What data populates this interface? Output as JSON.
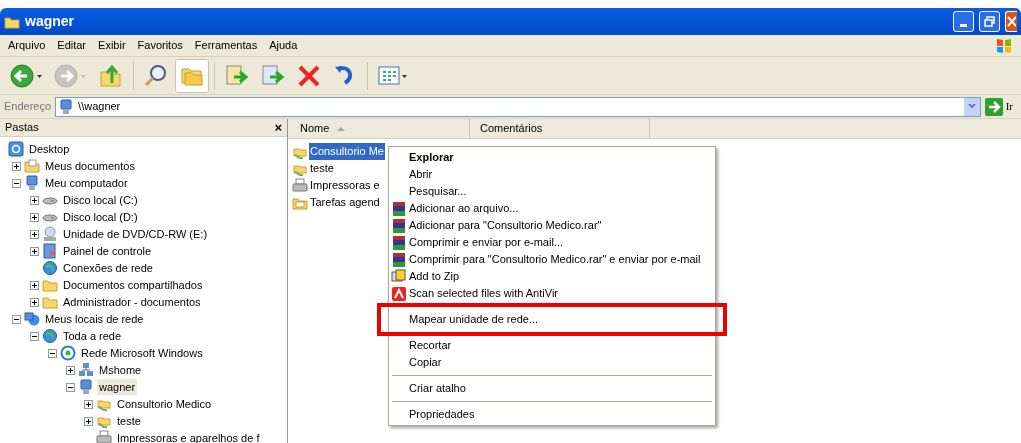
{
  "window": {
    "title": "wagner"
  },
  "menu": [
    "Arquivo",
    "Editar",
    "Exibir",
    "Favoritos",
    "Ferramentas",
    "Ajuda"
  ],
  "toolbar": [
    {
      "kind": "back",
      "disabled": false
    },
    {
      "kind": "forward",
      "disabled": true
    },
    {
      "kind": "up",
      "disabled": false
    },
    {
      "kind": "search",
      "disabled": false
    },
    {
      "kind": "folders",
      "disabled": false,
      "pressed": true
    },
    {
      "kind": "move",
      "disabled": false
    },
    {
      "kind": "copy",
      "disabled": false
    },
    {
      "kind": "delete",
      "disabled": false
    },
    {
      "kind": "undo",
      "disabled": false
    },
    {
      "kind": "views",
      "disabled": false
    }
  ],
  "address": {
    "label": "Endereço",
    "value": "\\\\wagner",
    "go": "Ir"
  },
  "folders_pane": {
    "title": "Pastas",
    "close": "×"
  },
  "tree": [
    {
      "label": "Desktop",
      "kind": "desktop",
      "children": [
        {
          "label": "Meus documentos",
          "kind": "docs",
          "expanded": false
        },
        {
          "label": "Meu computador",
          "kind": "computer",
          "expanded": true,
          "children": [
            {
              "label": "Disco local (C:)",
              "kind": "disk",
              "expanded": false
            },
            {
              "label": "Disco local (D:)",
              "kind": "disk",
              "expanded": false
            },
            {
              "label": "Unidade de DVD/CD-RW (E:)",
              "kind": "dvd",
              "expanded": false
            },
            {
              "label": "Painel de controle",
              "kind": "panel",
              "expanded": false
            },
            {
              "label": "Conexões de rede",
              "kind": "globe"
            },
            {
              "label": "Documentos compartilhados",
              "kind": "folder",
              "expanded": false
            },
            {
              "label": "Administrador - documentos",
              "kind": "folder",
              "expanded": false
            }
          ]
        },
        {
          "label": "Meus locais de rede",
          "kind": "network",
          "expanded": true,
          "children": [
            {
              "label": "Toda a rede",
              "kind": "globe",
              "expanded": true,
              "children": [
                {
                  "label": "Rede Microsoft Windows",
                  "kind": "msnet",
                  "expanded": true,
                  "children": [
                    {
                      "label": "Mshome",
                      "kind": "workgroup",
                      "expanded": false
                    },
                    {
                      "label": "wagner",
                      "kind": "computer",
                      "expanded": true,
                      "selected": true,
                      "children": [
                        {
                          "label": "Consultorio Medico",
                          "kind": "share",
                          "expanded": false,
                          "selected": false
                        },
                        {
                          "label": "teste",
                          "kind": "share",
                          "expanded": false,
                          "selected": false
                        },
                        {
                          "label": "Impressoras e aparelhos de f",
                          "kind": "printer",
                          "selected": false
                        }
                      ]
                    }
                  ]
                }
              ]
            }
          ]
        }
      ]
    }
  ],
  "columns": [
    "Nome",
    "Comentários"
  ],
  "files": [
    {
      "name": "Consultorio Me",
      "kind": "share",
      "selected": true
    },
    {
      "name": "teste",
      "kind": "share",
      "selected": false
    },
    {
      "name": "Impressoras e",
      "kind": "printer",
      "selected": false
    },
    {
      "name": "Tarefas agend",
      "kind": "tasks",
      "selected": false
    }
  ],
  "context_menu": [
    {
      "kind": "plain",
      "label": "Explorar",
      "bold": true
    },
    {
      "kind": "plain",
      "label": "Abrir",
      "bold": false
    },
    {
      "kind": "plain",
      "label": "Pesquisar...",
      "bold": false
    },
    {
      "kind": "rar",
      "label": "Adicionar ao arquivo...",
      "bold": false
    },
    {
      "kind": "rar",
      "label": "Adicionar para \"Consultorio Medico.rar\"",
      "bold": false
    },
    {
      "kind": "rar",
      "label": "Comprimir e enviar por e-mail...",
      "bold": false
    },
    {
      "kind": "rar",
      "label": "Comprimir para \"Consultorio Medico.rar\" e enviar por e-mail",
      "bold": false
    },
    {
      "kind": "zip",
      "label": "Add to Zip",
      "bold": false
    },
    {
      "kind": "antivir",
      "label": "Scan selected files with AntiVir",
      "bold": false
    },
    {
      "kind": "separator"
    },
    {
      "kind": "plain",
      "label": "Mapear unidade de rede...",
      "bold": false,
      "highlighted": true
    },
    {
      "kind": "separator"
    },
    {
      "kind": "plain",
      "label": "Recortar",
      "bold": false
    },
    {
      "kind": "plain",
      "label": "Copiar",
      "bold": false
    },
    {
      "kind": "separator"
    },
    {
      "kind": "plain",
      "label": "Criar atalho",
      "bold": false
    },
    {
      "kind": "separator"
    },
    {
      "kind": "plain",
      "label": "Propriedades",
      "bold": false
    }
  ]
}
